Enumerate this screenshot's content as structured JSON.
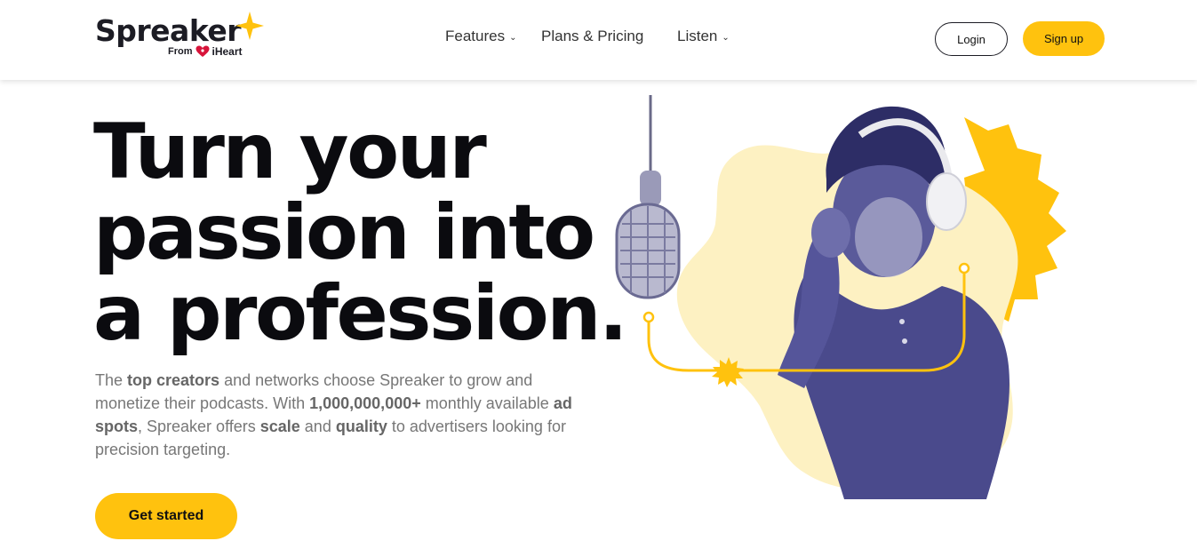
{
  "header": {
    "logo": {
      "word": "Spreaker",
      "from_label": "From",
      "brand": "iHeart"
    },
    "nav": [
      {
        "label": "Features",
        "has_dropdown": true
      },
      {
        "label": "Plans & Pricing",
        "has_dropdown": false
      },
      {
        "label": "Listen",
        "has_dropdown": true
      }
    ],
    "login_label": "Login",
    "signup_label": "Sign up"
  },
  "hero": {
    "title_lines": [
      "Turn your",
      "passion into",
      "a profession."
    ],
    "description": {
      "p1": "The ",
      "b1": "top creators",
      "p2": " and networks choose Spreaker to grow and monetize their podcasts. With ",
      "b2": "1,000,000,000+",
      "p3": " monthly available ",
      "b3": "ad spots",
      "p4": ", Spreaker offers ",
      "b4": "scale",
      "p5": " and ",
      "b5": "quality",
      "p6": " to advertisers looking for precision targeting."
    },
    "cta_label": "Get started"
  },
  "colors": {
    "accent": "#ffc20e",
    "blob_light": "#fdf1c2",
    "figure_purple": "#4a4a8c",
    "text_dark": "#0b0b0f",
    "text_muted": "#777777"
  }
}
